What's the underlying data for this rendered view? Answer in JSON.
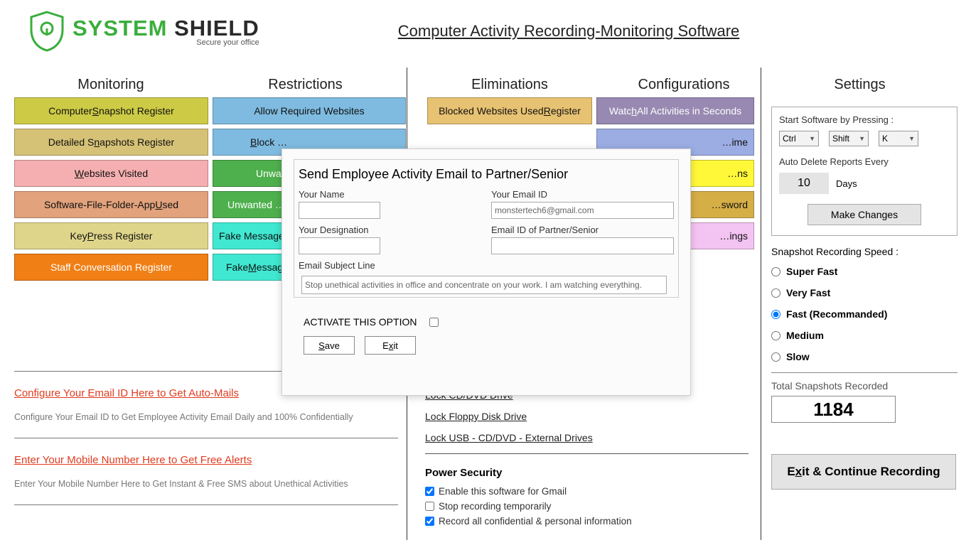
{
  "header": {
    "logo_sys": "SYSTEM",
    "logo_shield": " SHIELD",
    "logo_sub": "Secure your office",
    "app_title": "Computer Activity Recording-Monitoring Software"
  },
  "cols": {
    "h1": "Monitoring",
    "h2": "Restrictions",
    "h3": "Eliminations",
    "h4": "Configurations",
    "h5": "Settings"
  },
  "monitoring": {
    "b1a": "Computer ",
    "b1u": "S",
    "b1b": "napshot Register",
    "b2a": "Detailed S",
    "b2u": "n",
    "b2b": "apshots Register",
    "b3u": "W",
    "b3b": "ebsites Visited",
    "b4a": "Software-File-Folder-App ",
    "b4u": "U",
    "b4b": "sed",
    "b5a": "Key",
    "b5u": "P",
    "b5b": "ress Register",
    "b6": "Staff Conversation Register"
  },
  "restrictions": {
    "b1": "Allow Required Websites",
    "b2u": "B",
    "b2b": "lock …",
    "b3": "Unwa…",
    "b4": "Unwanted …",
    "b5": "Fake Messages",
    "b6a": "Fake ",
    "b6u": "M",
    "b6b": "essag…"
  },
  "eliminations": {
    "b1a": "Blocked Websites Used ",
    "b1u": "R",
    "b1b": "egister"
  },
  "configurations": {
    "b1a": "Watc",
    "b1u": "h",
    "b1b": " All Activities in Seconds",
    "b2": "…ime",
    "b3": "…ns",
    "b4": "…sword",
    "b5": "…ings"
  },
  "left_lower": {
    "link1": "Configure Your Email ID Here to Get Auto-Mails",
    "desc1": "Configure Your Email ID to Get Employee Activity Email Daily and 100% Confidentially",
    "link2": "Enter Your Mobile Number Here to Get Free Alerts",
    "desc2": "Enter Your Mobile Number Here to Get Instant & Free SMS about Unethical Activities"
  },
  "locks": {
    "l1": "Lock CD/DVD Drive",
    "l2": "Lock Floppy Disk Drive",
    "l3": "Lock USB - CD/DVD - External Drives"
  },
  "power": {
    "title": "Power Security",
    "c1": "Enable this software for Gmail",
    "c2": "Stop recording temporarily",
    "c3": "Record all confidential & personal information"
  },
  "settings": {
    "start_label": "Start Software by Pressing :",
    "sel1": "Ctrl",
    "sel2": "Shift",
    "sel3": "K",
    "auto_label": "Auto Delete Reports Every",
    "days_val": "10",
    "days_txt": "Days",
    "make_btn": "Make Changes",
    "speed_title": "Snapshot Recording Speed :",
    "r1": "Super Fast",
    "r2": "Very Fast",
    "r3": "Fast (Recommanded)",
    "r4": "Medium",
    "r5": "Slow",
    "tot_label": "Total Snapshots Recorded",
    "tot_val": "1184",
    "exit_a": "E",
    "exit_u": "x",
    "exit_b": "it & Continue Recording"
  },
  "dialog": {
    "title": "Send Employee Activity Email to Partner/Senior",
    "name_lbl": "Your Name",
    "email_lbl": "Your Email ID",
    "email_val": "monstertech6@gmail.com",
    "desig_lbl": "Your Designation",
    "partner_lbl": "Email ID of Partner/Senior",
    "subj_lbl": "Email Subject Line",
    "subj_val": "Stop unethical activities in office and concentrate on your work. I am watching everything.",
    "activate": "ACTIVATE THIS OPTION",
    "save_a": "",
    "save_u": "S",
    "save_b": "ave",
    "exit_a": "E",
    "exit_u": "x",
    "exit_b": "it"
  }
}
